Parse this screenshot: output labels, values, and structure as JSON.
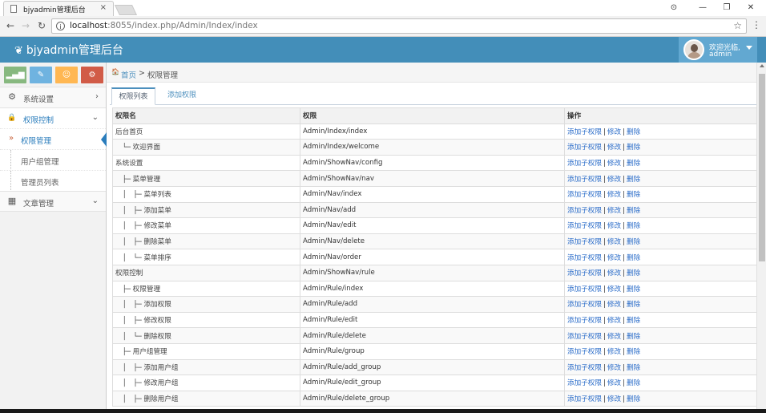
{
  "browser": {
    "tab_title": "bjyadmin管理后台",
    "tab_close": "×",
    "url_host": "localhost",
    "url_path": ":8055/index.php/Admin/Index/index",
    "info_glyph": "i",
    "bookmark_glyph": "☆",
    "menu_glyph": "⋮",
    "back_glyph": "←",
    "forward_glyph": "→",
    "reload_glyph": "↻",
    "win_account": "⊙",
    "win_min": "—",
    "win_max": "❐",
    "win_close": "✕"
  },
  "header": {
    "brand": "bjyadmin管理后台",
    "brand_icon": "❦",
    "user_welcome": "欢迎光临,",
    "user_name": "admin"
  },
  "sidebar": {
    "shortcut_colors": [
      "#87b87f",
      "#6fb3e0",
      "#ffb752",
      "#d15b47"
    ],
    "shortcut_glyphs": [
      "▂▄▆",
      "✎",
      "☺",
      "⚙"
    ],
    "menu": [
      {
        "label": "系统设置",
        "icon": "⚙",
        "chevron": "›"
      },
      {
        "label": "权限控制",
        "icon": "🔒",
        "chevron": "⌄"
      },
      {
        "label": "文章管理",
        "icon": "▦",
        "chevron": "⌄"
      }
    ],
    "submenu": [
      {
        "label": "权限管理",
        "bullet": "»"
      },
      {
        "label": "用户组管理"
      },
      {
        "label": "管理员列表"
      }
    ]
  },
  "breadcrumb": {
    "home": "首页",
    "separator": ">",
    "current": "权限管理",
    "home_icon": "🏠"
  },
  "tabs": [
    {
      "label": "权限列表"
    },
    {
      "label": "添加权限"
    }
  ],
  "table": {
    "columns": [
      "权限名",
      "权限",
      "操作"
    ],
    "actions": [
      "添加子权限",
      "修改",
      "删除"
    ],
    "action_sep": "|",
    "rows": [
      {
        "name": "后台首页",
        "rule": "Admin/Index/index"
      },
      {
        "name": "　└─ 欢迎界面",
        "rule": "Admin/Index/welcome"
      },
      {
        "name": "系统设置",
        "rule": "Admin/ShowNav/config"
      },
      {
        "name": "　├─ 菜单管理",
        "rule": "Admin/ShowNav/nav"
      },
      {
        "name": "　│　├─ 菜单列表",
        "rule": "Admin/Nav/index"
      },
      {
        "name": "　│　├─ 添加菜单",
        "rule": "Admin/Nav/add"
      },
      {
        "name": "　│　├─ 修改菜单",
        "rule": "Admin/Nav/edit"
      },
      {
        "name": "　│　├─ 删除菜单",
        "rule": "Admin/Nav/delete"
      },
      {
        "name": "　│　└─ 菜单排序",
        "rule": "Admin/Nav/order"
      },
      {
        "name": "权限控制",
        "rule": "Admin/ShowNav/rule"
      },
      {
        "name": "　├─ 权限管理",
        "rule": "Admin/Rule/index"
      },
      {
        "name": "　│　├─ 添加权限",
        "rule": "Admin/Rule/add"
      },
      {
        "name": "　│　├─ 修改权限",
        "rule": "Admin/Rule/edit"
      },
      {
        "name": "　│　└─ 删除权限",
        "rule": "Admin/Rule/delete"
      },
      {
        "name": "　├─ 用户组管理",
        "rule": "Admin/Rule/group"
      },
      {
        "name": "　│　├─ 添加用户组",
        "rule": "Admin/Rule/add_group"
      },
      {
        "name": "　│　├─ 修改用户组",
        "rule": "Admin/Rule/edit_group"
      },
      {
        "name": "　│　├─ 删除用户组",
        "rule": "Admin/Rule/delete_group"
      }
    ]
  },
  "colors": {
    "header_bg": "#438eb9",
    "user_bg": "#62a8d1",
    "link": "#2a6cc9",
    "active_menu": "#2b7dbc"
  }
}
